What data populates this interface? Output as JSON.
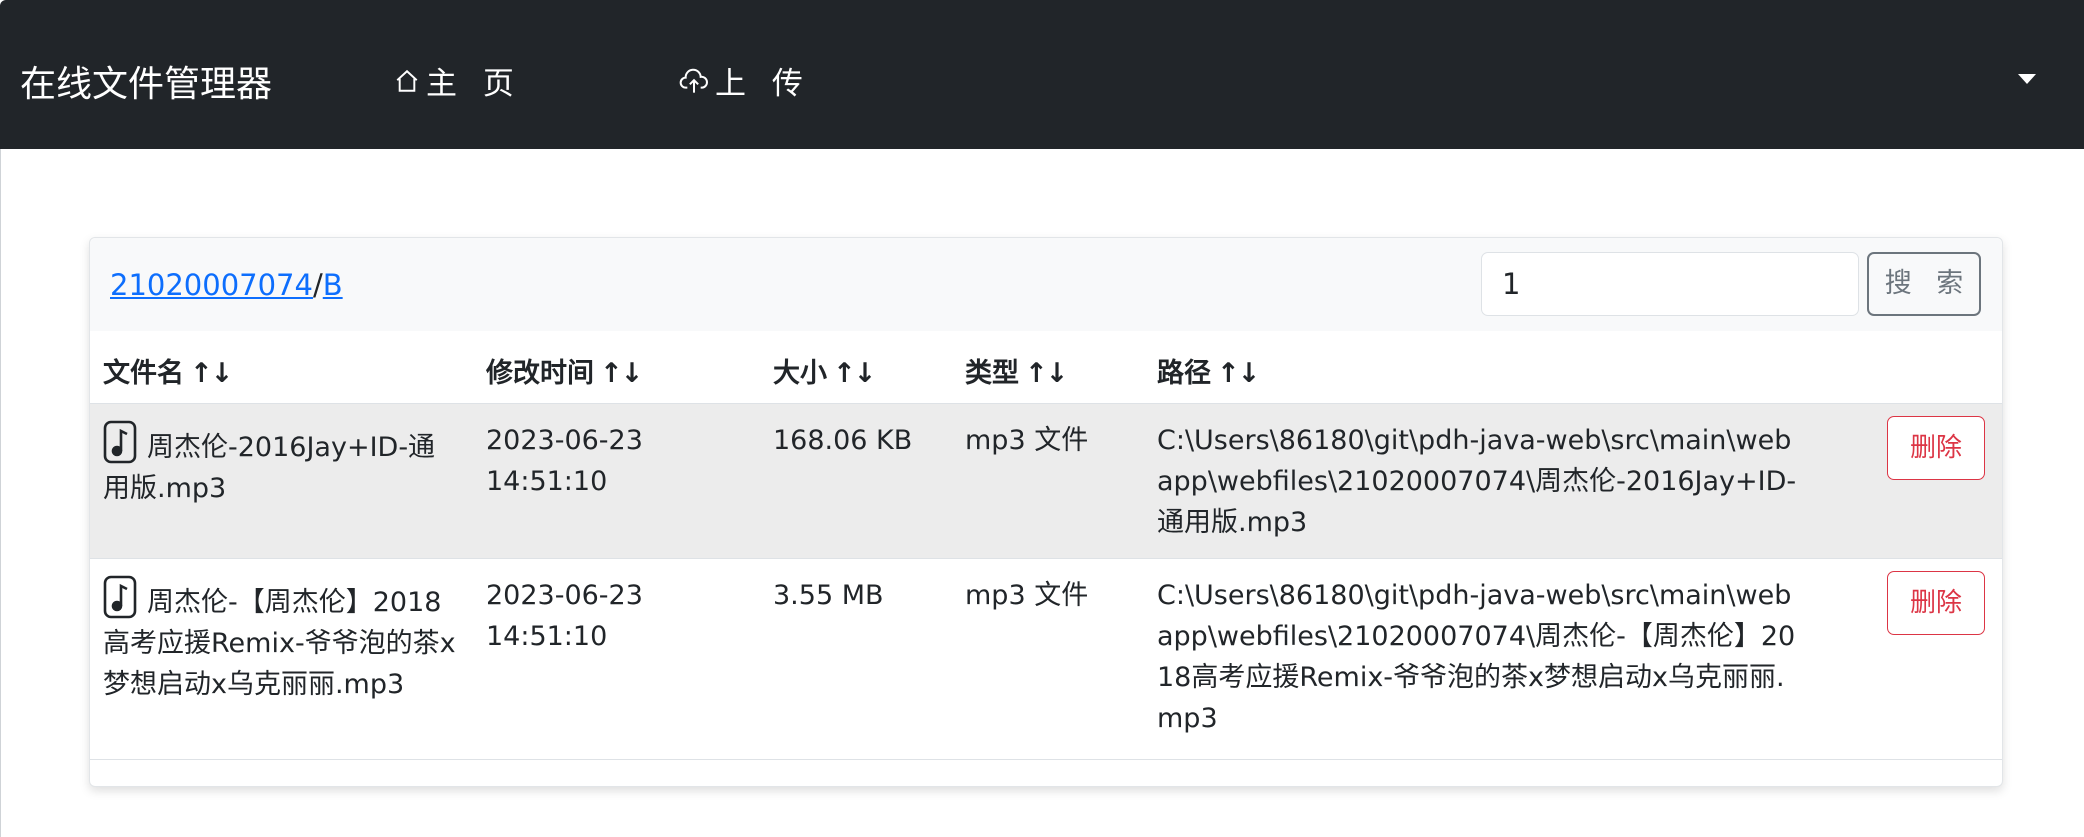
{
  "navbar": {
    "brand": "在线文件管理器",
    "home_label": "主 页",
    "upload_label": "上 传"
  },
  "breadcrumb": {
    "user": "21020007074",
    "separator": "/",
    "folder": "B"
  },
  "search": {
    "value": "1",
    "button_label": "搜 索"
  },
  "table": {
    "headers": {
      "name": "文件名",
      "modified": "修改时间",
      "size": "大小",
      "type": "类型",
      "path": "路径",
      "sort_glyph": "↑↓"
    },
    "rows": [
      {
        "name": "周杰伦-2016Jay+ID-通用版.mp3",
        "modified": "2023-06-23 14:51:10",
        "size": "168.06 KB",
        "type": "mp3 文件",
        "path": "C:\\Users\\86180\\git\\pdh-java-web\\src\\main\\webapp\\webfiles\\21020007074\\周杰伦-2016Jay+ID-通用版.mp3",
        "delete_label": "删除"
      },
      {
        "name": "周杰伦-【周杰伦】2018高考应援Remix-爷爷泡的茶x梦想启动x乌克丽丽.mp3",
        "modified": "2023-06-23 14:51:10",
        "size": "3.55 MB",
        "type": "mp3 文件",
        "path": "C:\\Users\\86180\\git\\pdh-java-web\\src\\main\\webapp\\webfiles\\21020007074\\周杰伦-【周杰伦】2018高考应援Remix-爷爷泡的茶x梦想启动x乌克丽丽.mp3",
        "delete_label": "删除"
      }
    ]
  },
  "icons": {
    "home": "house-icon",
    "upload": "cloud-upload-icon",
    "file": "file-music-icon",
    "dropdown": "caret-down-icon"
  },
  "colors": {
    "navbar_bg": "#212529",
    "link": "#0d6efd",
    "danger": "#dc3545",
    "row_highlight": "#ececec"
  }
}
